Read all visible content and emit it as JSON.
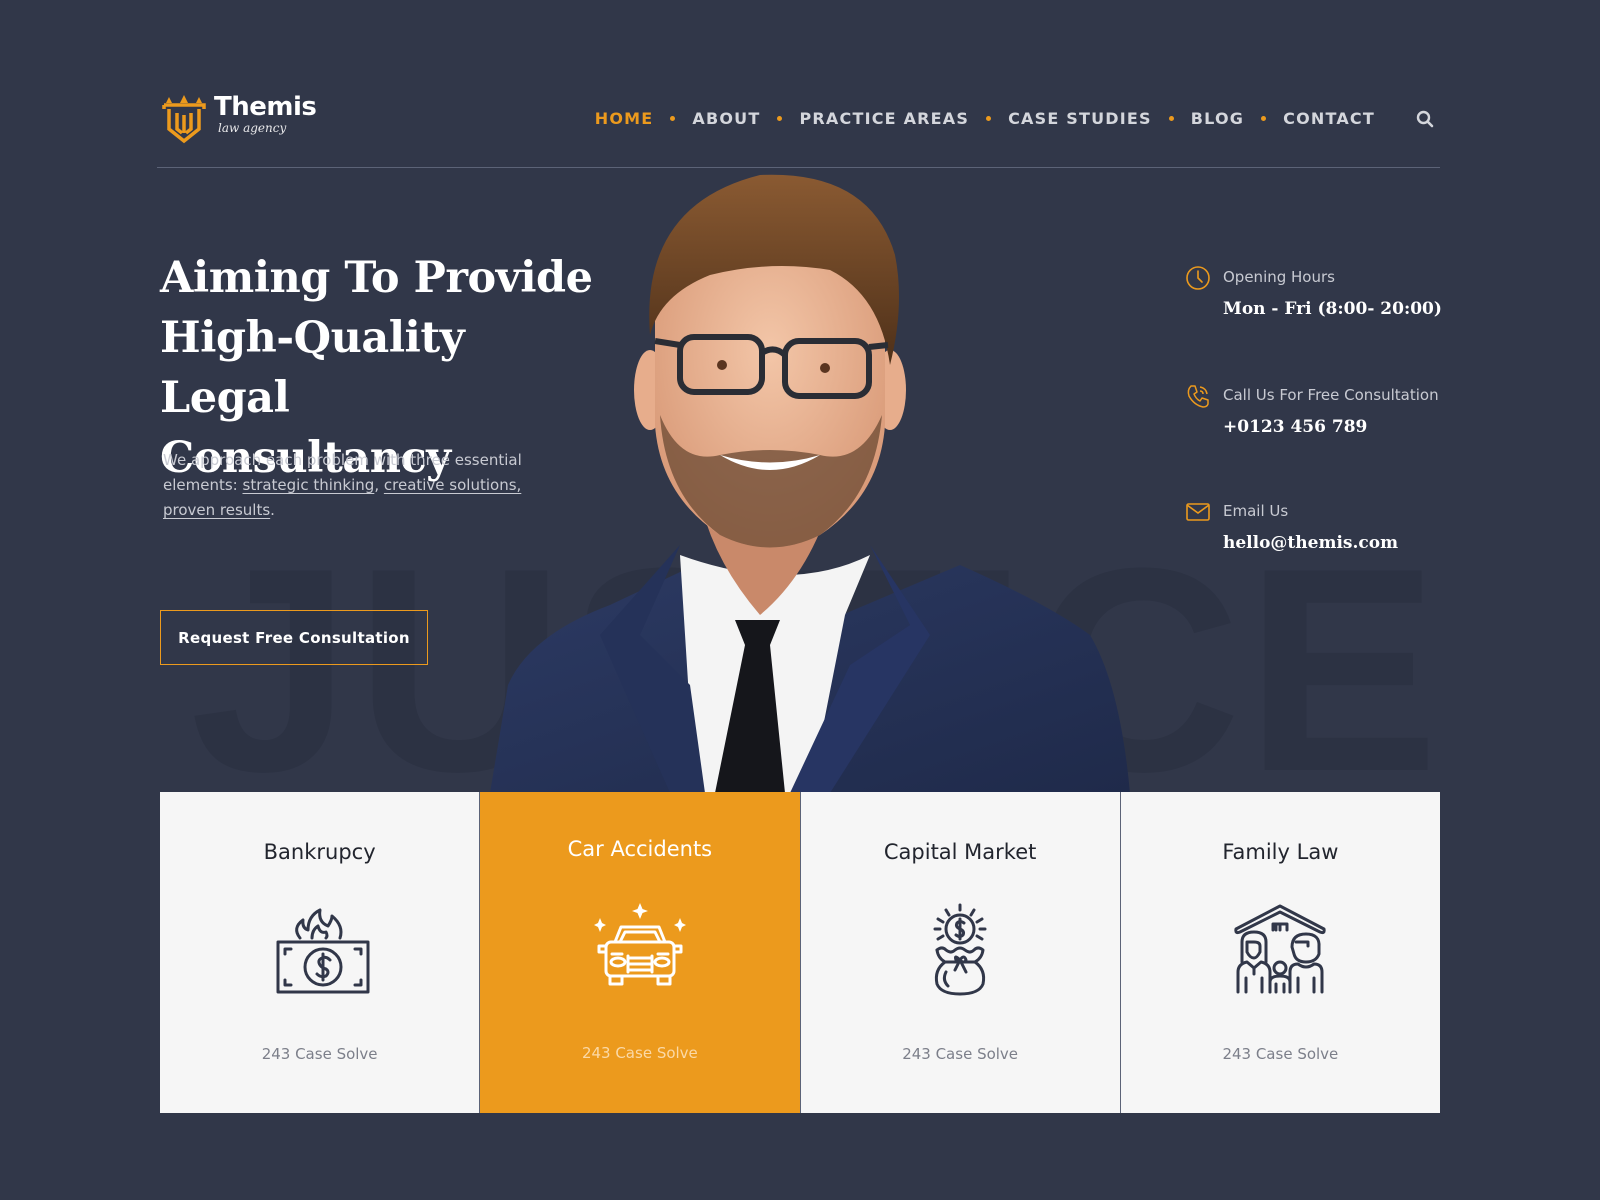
{
  "brand": {
    "name": "Themis",
    "tagline": "law agency",
    "accent_color": "#ec9a1d",
    "background_color": "#313749"
  },
  "nav": {
    "items": [
      {
        "label": "HOME",
        "active": true
      },
      {
        "label": "ABOUT",
        "active": false
      },
      {
        "label": "PRACTICE AREAS",
        "active": false
      },
      {
        "label": "CASE STUDIES",
        "active": false
      },
      {
        "label": "BLOG",
        "active": false
      },
      {
        "label": "CONTACT",
        "active": false
      }
    ],
    "search_icon": "search-icon"
  },
  "hero": {
    "title_lines": [
      "Aiming To Provide",
      "High-Quality Legal",
      "Consultancy"
    ],
    "description_intro": "We approach each problem with three essential elements: ",
    "links": [
      "strategic thinking",
      "creative solutions,",
      "proven results"
    ],
    "separator": ", ",
    "period": ".",
    "cta_label": "Request Free Consultation",
    "watermark": "JUSTICE"
  },
  "contact": {
    "items": [
      {
        "icon": "clock-icon",
        "label": "Opening Hours",
        "value": "Mon - Fri (8:00- 20:00)"
      },
      {
        "icon": "phone-icon",
        "label": "Call Us For Free Consultation",
        "value": "+0123 456 789"
      },
      {
        "icon": "mail-icon",
        "label": "Email Us",
        "value": "hello@themis.com"
      }
    ]
  },
  "services": {
    "cards": [
      {
        "title": "Bankrupcy",
        "count": "243 Case Solve",
        "icon": "burning-money-icon",
        "featured": false
      },
      {
        "title": "Car Accidents",
        "count": "243 Case Solve",
        "icon": "car-icon",
        "featured": true
      },
      {
        "title": "Capital Market",
        "count": "243 Case Solve",
        "icon": "money-bag-icon",
        "featured": false
      },
      {
        "title": "Family Law",
        "count": "243 Case Solve",
        "icon": "family-house-icon",
        "featured": false
      }
    ]
  }
}
